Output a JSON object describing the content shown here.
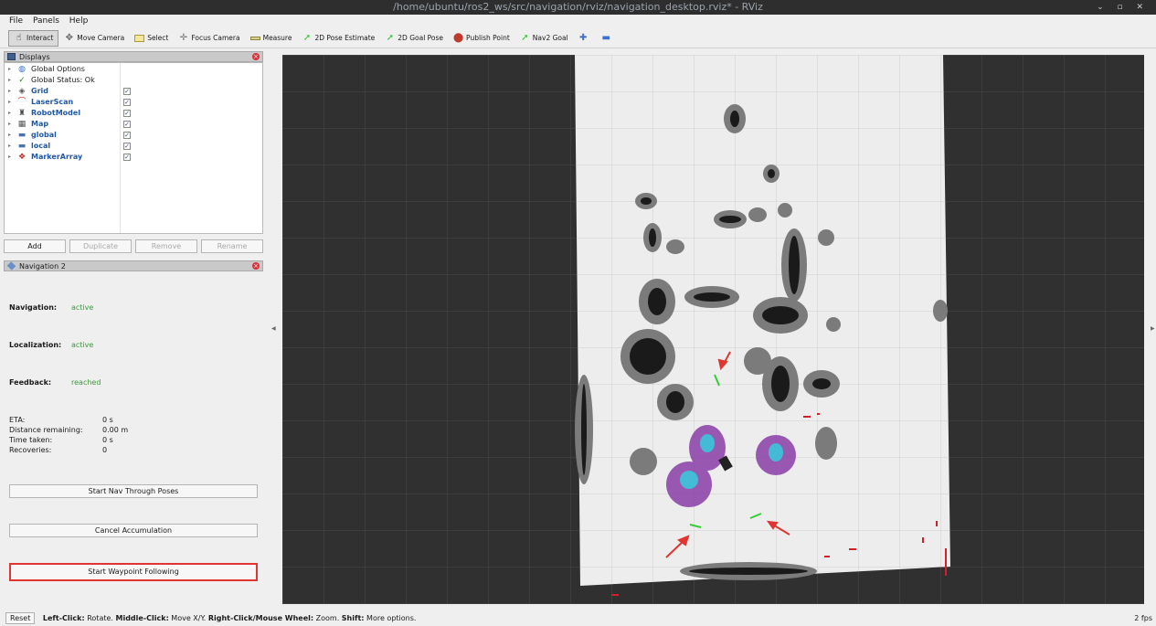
{
  "window": {
    "title": "/home/ubuntu/ros2_ws/src/navigation/rviz/navigation_desktop.rviz* - RViz"
  },
  "menu": {
    "file": "File",
    "panels": "Panels",
    "help": "Help"
  },
  "toolbar": {
    "tools": [
      {
        "label": "Interact",
        "icon": "interact-icon",
        "active": true
      },
      {
        "label": "Move Camera",
        "icon": "move-camera-icon"
      },
      {
        "label": "Select",
        "icon": "select-icon"
      },
      {
        "label": "Focus Camera",
        "icon": "focus-camera-icon"
      },
      {
        "label": "Measure",
        "icon": "ruler-icon"
      },
      {
        "label": "2D Pose Estimate",
        "icon": "green-arrow-icon"
      },
      {
        "label": "2D Goal Pose",
        "icon": "green-arrow-icon"
      },
      {
        "label": "Publish Point",
        "icon": "map-pin-icon"
      },
      {
        "label": "Nav2 Goal",
        "icon": "green-arrow-icon"
      }
    ]
  },
  "displays": {
    "title": "Displays",
    "items": [
      {
        "label": "Global Options",
        "icon": "globe-icon",
        "bold": false,
        "checked": null
      },
      {
        "label": "Global Status: Ok",
        "icon": "checkmark-icon",
        "bold": false,
        "checked": null
      },
      {
        "label": "Grid",
        "icon": "grid-icon",
        "bold": true,
        "checked": true
      },
      {
        "label": "LaserScan",
        "icon": "laserscan-icon",
        "bold": true,
        "checked": true
      },
      {
        "label": "RobotModel",
        "icon": "robot-icon",
        "bold": true,
        "checked": true
      },
      {
        "label": "Map",
        "icon": "map-icon",
        "bold": true,
        "checked": true
      },
      {
        "label": "global",
        "icon": "folder-icon",
        "bold": true,
        "checked": true
      },
      {
        "label": "local",
        "icon": "folder-icon",
        "bold": true,
        "checked": true
      },
      {
        "label": "MarkerArray",
        "icon": "marker-icon",
        "bold": true,
        "checked": true
      }
    ],
    "buttons": {
      "add": "Add",
      "duplicate": "Duplicate",
      "remove": "Remove",
      "rename": "Rename"
    }
  },
  "nav2": {
    "title": "Navigation 2",
    "navigation_label": "Navigation:",
    "navigation_value": "active",
    "localization_label": "Localization:",
    "localization_value": "active",
    "feedback_label": "Feedback:",
    "feedback_value": "reached",
    "eta_label": "ETA:",
    "eta_value": "0 s",
    "distance_label": "Distance remaining:",
    "distance_value": "0.00 m",
    "time_label": "Time taken:",
    "time_value": "0 s",
    "recoveries_label": "Recoveries:",
    "recoveries_value": "0",
    "btn_through_poses": "Start Nav Through Poses",
    "btn_cancel_accum": "Cancel Accumulation",
    "btn_waypoint": "Start Waypoint Following"
  },
  "status": {
    "reset": "Reset",
    "hint_1b": "Left-Click:",
    "hint_1": " Rotate. ",
    "hint_2b": "Middle-Click:",
    "hint_2": " Move X/Y. ",
    "hint_3b": "Right-Click/Mouse Wheel:",
    "hint_3": " Zoom. ",
    "hint_4b": "Shift:",
    "hint_4": " More options.",
    "fps": "2 fps"
  },
  "colors": {
    "accent_blue": "#2058a8",
    "active_green": "#3a9a3a",
    "highlight_red": "#e03530",
    "viewport_bg": "#303030"
  }
}
